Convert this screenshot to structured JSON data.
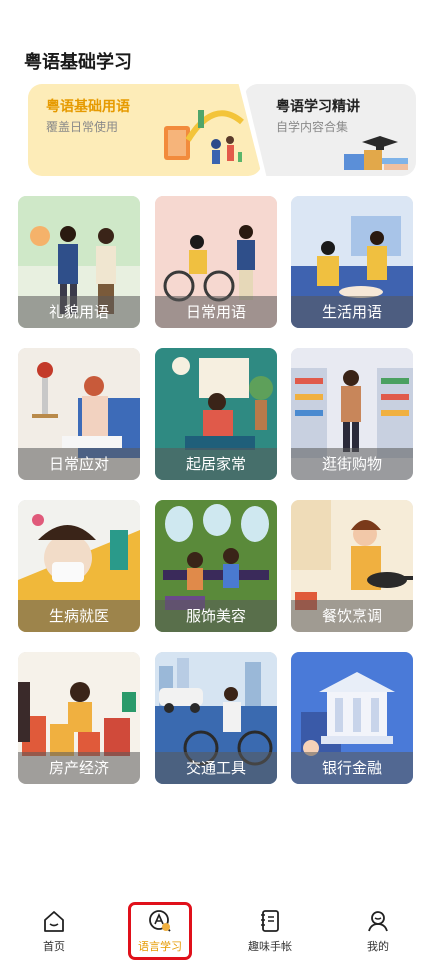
{
  "page_title": "粤语基础学习",
  "banners": [
    {
      "title": "粤语基础用语",
      "subtitle": "覆盖日常使用"
    },
    {
      "title": "粤语学习精讲",
      "subtitle": "自学内容合集"
    }
  ],
  "categories": [
    {
      "label": "礼貌用语"
    },
    {
      "label": "日常用语"
    },
    {
      "label": "生活用语"
    },
    {
      "label": "日常应对"
    },
    {
      "label": "起居家常"
    },
    {
      "label": "逛街购物"
    },
    {
      "label": "生病就医"
    },
    {
      "label": "服饰美容"
    },
    {
      "label": "餐饮烹调"
    },
    {
      "label": "房产经济"
    },
    {
      "label": "交通工具"
    },
    {
      "label": "银行金融"
    }
  ],
  "tabbar": {
    "home": "首页",
    "language": "语言学习",
    "notebook": "趣味手帐",
    "me": "我的"
  },
  "colors": {
    "accent": "#e69a00",
    "highlight": "#e0101a"
  }
}
